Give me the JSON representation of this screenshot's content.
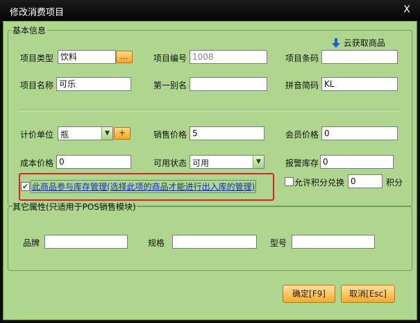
{
  "window": {
    "title": "修改消费项目",
    "close_glyph": "X"
  },
  "basic": {
    "legend": "基本信息",
    "cloud_fetch_label": "云获取商品",
    "type_label": "项目类型",
    "type_value": "饮料",
    "type_picker_label": "...",
    "code_label": "项目编号",
    "code_value": "1008",
    "barcode_label": "项目条码",
    "barcode_value": "",
    "name_label": "项目名称",
    "name_value": "可乐",
    "alias_label": "第一别名",
    "alias_value": "",
    "pinyin_label": "拼音简码",
    "pinyin_value": "KL",
    "unit_label": "计价单位",
    "unit_value": "瓶",
    "unit_add_label": "+",
    "price_label": "销售价格",
    "price_value": "5",
    "member_price_label": "会员价格",
    "member_price_value": "0",
    "cost_label": "成本价格",
    "cost_value": "0",
    "status_label": "可用状态",
    "status_value": "可用",
    "alarm_label": "报警库存",
    "alarm_value": "0",
    "inventory_checkbox_label": "此商品参与库存管理(选择此项的商品才能进行出入库的管理)",
    "inventory_checked": true,
    "points_checkbox_label": "允许积分兑换",
    "points_checked": false,
    "points_value": "0",
    "points_unit": "积分"
  },
  "other": {
    "legend": "其它属性(只适用于POS销售模块)",
    "brand_label": "品牌",
    "brand_value": "",
    "spec_label": "规格",
    "spec_value": "",
    "model_label": "型号",
    "model_value": ""
  },
  "footer": {
    "ok_label": "确定[F9]",
    "cancel_label": "取消[Esc]"
  },
  "colors": {
    "panel": "#aed68e",
    "accent_orange": "#f6ab2a",
    "highlight_red": "#e42020",
    "link_blue": "#1a2cb8"
  },
  "icons": {
    "cloud_fetch": "down-arrow-icon",
    "check": "check-icon"
  }
}
